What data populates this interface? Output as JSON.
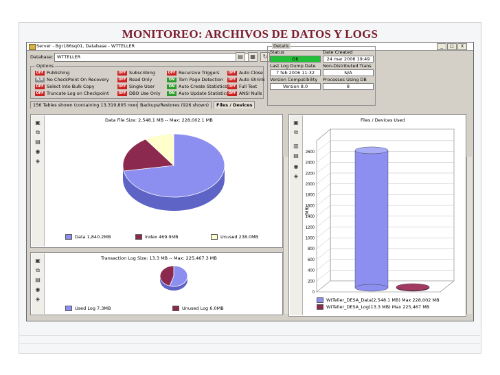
{
  "slide": {
    "title": "MONITOREO: ARCHIVOS DE DATOS Y LOGS"
  },
  "window": {
    "title": "Server - Bgr186sq01, Database - WTTELLER",
    "buttons": {
      "minimize": "_",
      "maximize": "□",
      "close": "X"
    }
  },
  "toolbar": {
    "database_label": "Database:",
    "database_value": "WTTELLER",
    "dropdown_glyph": "▼",
    "icons": [
      "export-icon",
      "report-icon",
      "refresh-icon"
    ]
  },
  "options": {
    "label": "Options",
    "col1": [
      {
        "state": "OFF",
        "label": "Publishing"
      },
      {
        "state": "N/A",
        "label": "No CheckPoint On Recovery"
      },
      {
        "state": "OFF",
        "label": "Select Into Bulk Copy"
      },
      {
        "state": "OFF",
        "label": "Truncate Log on Checkpoint"
      }
    ],
    "col2": [
      {
        "state": "OFF",
        "label": "Subscribing"
      },
      {
        "state": "OFF",
        "label": "Read Only"
      },
      {
        "state": "OFF",
        "label": "Single User"
      },
      {
        "state": "OFF",
        "label": "DBO Use Only"
      }
    ],
    "col3": [
      {
        "state": "OFF",
        "label": "Recursive Triggers"
      },
      {
        "state": "ON",
        "label": "Torn Page Detection"
      },
      {
        "state": "ON",
        "label": "Auto Create Statistics"
      },
      {
        "state": "ON",
        "label": "Auto Update Statistics"
      }
    ],
    "col4": [
      {
        "state": "OFF",
        "label": "Auto Close"
      },
      {
        "state": "OFF",
        "label": "Auto Shrink"
      },
      {
        "state": "OFF",
        "label": "Full Text"
      },
      {
        "state": "OFF",
        "label": "ANSI Nulls"
      }
    ]
  },
  "details": {
    "label": "Details",
    "status_label": "Status",
    "status_value": "OK",
    "date_created_label": "Date Created",
    "date_created_value": "24 mar 2006 19:49",
    "last_log_dump_label": "Last Log Dump Date",
    "last_log_dump_value": "7 feb 2006 11:32",
    "non_distributed_label": "Non-Distributed Trans",
    "non_distributed_value": "N/A",
    "version_compat_label": "Version Compatibility",
    "version_compat_value": "Version 8.0",
    "processes_label": "Processes Using DB",
    "processes_value": "8"
  },
  "tabs": [
    {
      "label": "156 Tables shown (containing 13,319,805 rows)"
    },
    {
      "label": "Backups/Restores (926 shown)"
    },
    {
      "label": "Files / Devices"
    }
  ],
  "data_pie": {
    "title": "Data File Size: 2,548.1 MB -- Max: 228,002.1 MB",
    "legend": [
      {
        "label": "Data 1,840.2MB",
        "color": "#8c8ff0"
      },
      {
        "label": "Index 469.9MB",
        "color": "#8b2a4e"
      },
      {
        "label": "Unused 238.0MB",
        "color": "#ffffcc"
      }
    ]
  },
  "log_pie": {
    "title": "Transaction Log Size: 13.3 MB -- Max: 225,467.3 MB",
    "legend": [
      {
        "label": "Used Log 7.3MB",
        "color": "#8c8ff0"
      },
      {
        "label": "Unused Log 6.0MB",
        "color": "#8b2a4e"
      }
    ]
  },
  "files_chart": {
    "title": "Files / Devices Used",
    "ylabel": "(MB)",
    "yticks": [
      "0",
      "200",
      "400",
      "600",
      "800",
      "1000",
      "1200",
      "1400",
      "1600",
      "1800",
      "2000",
      "2200",
      "2400",
      "2600"
    ],
    "legend": [
      {
        "label": "WtTeller_DESA_Data(2,548.1 MB) Max 228,002 MB",
        "color": "#8c8ff0"
      },
      {
        "label": "WtTeller_DESA_Log(13.3 MB) Max 225,467 MB",
        "color": "#8b2a4e"
      }
    ]
  },
  "chart_data": [
    {
      "type": "pie",
      "title": "Data File Size: 2,548.1 MB -- Max: 228,002.1 MB",
      "categories": [
        "Data",
        "Index",
        "Unused"
      ],
      "values": [
        1840.2,
        469.9,
        238.0
      ],
      "colors": [
        "#8c8ff0",
        "#8b2a4e",
        "#ffffcc"
      ]
    },
    {
      "type": "pie",
      "title": "Transaction Log Size: 13.3 MB -- Max: 225,467.3 MB",
      "categories": [
        "Used Log",
        "Unused Log"
      ],
      "values": [
        7.3,
        6.0
      ],
      "colors": [
        "#8c8ff0",
        "#8b2a4e"
      ]
    },
    {
      "type": "bar",
      "title": "Files / Devices Used",
      "ylabel": "(MB)",
      "ylim": [
        0,
        2700
      ],
      "categories": [
        "WtTeller_DESA_Data",
        "WtTeller_DESA_Log"
      ],
      "values": [
        2548.1,
        13.3
      ],
      "colors": [
        "#8c8ff0",
        "#8b2a4e"
      ],
      "grid": true
    }
  ]
}
